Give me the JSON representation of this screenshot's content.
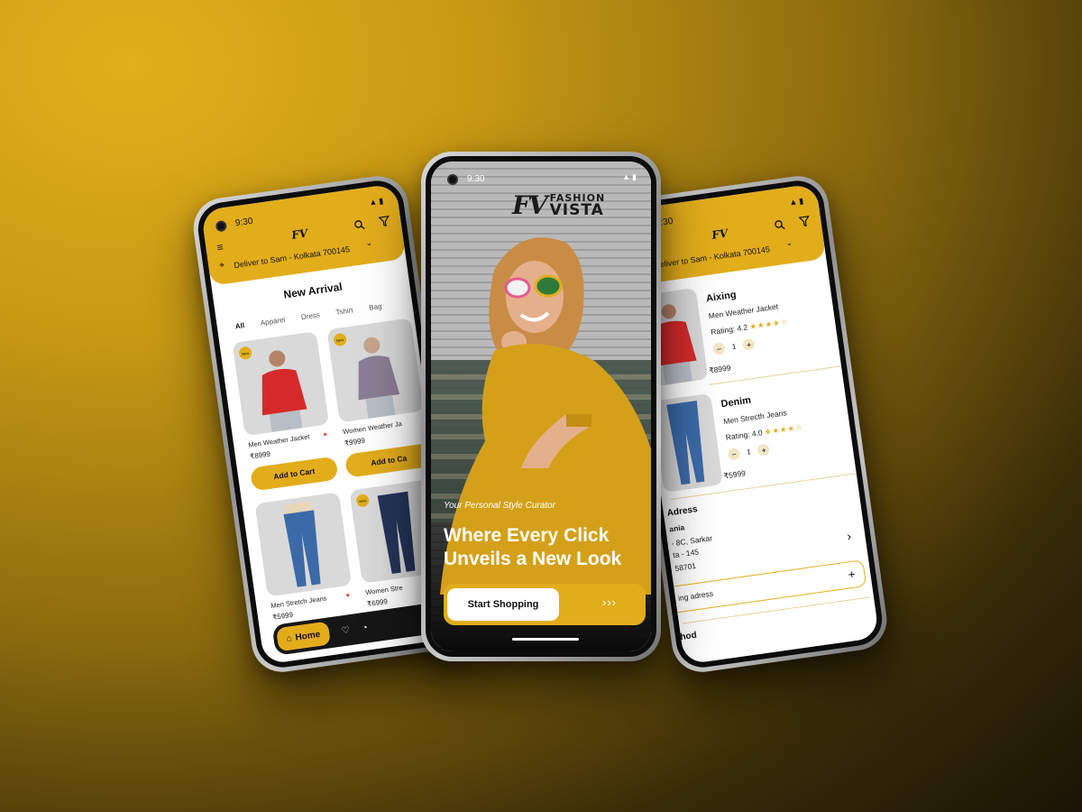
{
  "colors": {
    "accent": "#e2ad1b",
    "dark": "#161616",
    "background": "#c99a14"
  },
  "status_time": "9:30",
  "left": {
    "logo": "FV",
    "deliver": "Deliver to Sam - Kolkata 700145",
    "section_title": "New Arrival",
    "categories": [
      "All",
      "Apparel",
      "Dress",
      "Tshirt",
      "Bag"
    ],
    "products": [
      {
        "name": "Men Weather Jacket",
        "price": "₹8999",
        "badge": "New"
      },
      {
        "name": "Women Weather Ja",
        "price": "₹9999",
        "badge": "New"
      },
      {
        "name": "Men Stretch Jeans",
        "price": "₹5999",
        "badge": ""
      },
      {
        "name": "Women Stre",
        "price": "₹6999",
        "badge": "New"
      }
    ],
    "add_to_cart": "Add to Cart",
    "add_to_cart_short": "Add to Ca",
    "nav_home": "Home",
    "icons": [
      "menu-icon",
      "search-icon",
      "filter-icon",
      "location-icon",
      "heart-icon",
      "user-icon",
      "home-icon"
    ]
  },
  "center": {
    "logo_mark": "FV",
    "logo_line1": "FASHION",
    "logo_line2": "VISTA",
    "tagline": "Your Personal Style Curator",
    "headline": "Where Every Click Unveils a New Look",
    "cta_label": "Start Shopping",
    "cta_arrows": "›››"
  },
  "right": {
    "logo": "FV",
    "deliver": "Deliver to Sam - Kolkata 700145",
    "items": [
      {
        "brand": "Aixing",
        "name": "Men Weather Jacket",
        "rating_label": "Rating: 4.2",
        "stars": "★★★★☆",
        "qty": "1",
        "price": "₹8999"
      },
      {
        "brand": "Denim",
        "name": "Men Strecth Jeans",
        "rating_label": "Rating: 4.0",
        "stars": "★★★★☆",
        "qty": "1",
        "price": "₹5999"
      }
    ],
    "address_title": "Adress",
    "address_name": "ania",
    "address_line1": "- 8C, Sarkar",
    "address_line2": "ta - 145",
    "address_line3": "58701",
    "add_address": "ing adress",
    "method_title": "thod"
  }
}
